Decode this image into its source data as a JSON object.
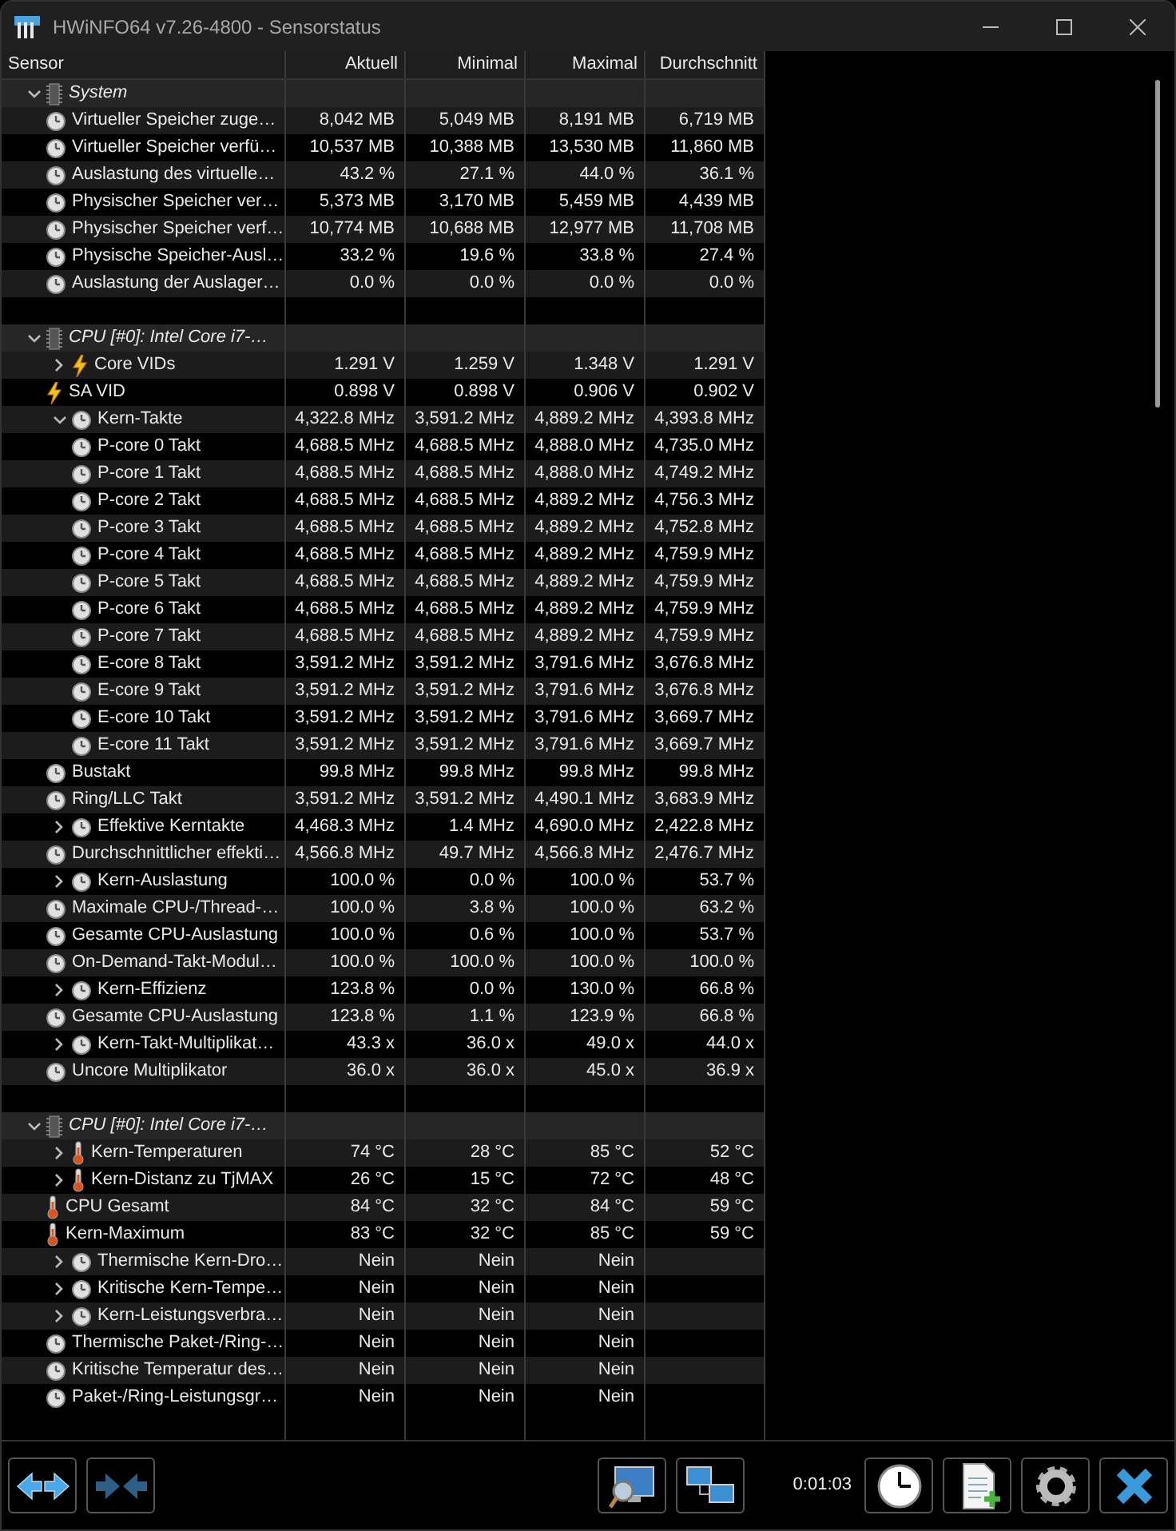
{
  "window": {
    "title": "HWiNFO64 v7.26-4800 - Sensorstatus"
  },
  "columns": [
    "Sensor",
    "Aktuell",
    "Minimal",
    "Maximal",
    "Durchschnitt"
  ],
  "groups": [
    {
      "label": "System",
      "expanded": true,
      "children": [
        {
          "label": "Virtueller Speicher zuge…",
          "kind": "gauge",
          "values": [
            "8,042 MB",
            "5,049 MB",
            "8,191 MB",
            "6,719 MB"
          ]
        },
        {
          "label": "Virtueller Speicher verfü…",
          "kind": "gauge",
          "values": [
            "10,537 MB",
            "10,388 MB",
            "13,530 MB",
            "11,860 MB"
          ]
        },
        {
          "label": "Auslastung des virtuelle…",
          "kind": "gauge",
          "values": [
            "43.2 %",
            "27.1 %",
            "44.0 %",
            "36.1 %"
          ]
        },
        {
          "label": "Physischer Speicher ver…",
          "kind": "gauge",
          "values": [
            "5,373 MB",
            "3,170 MB",
            "5,459 MB",
            "4,439 MB"
          ]
        },
        {
          "label": "Physischer Speicher verf…",
          "kind": "gauge",
          "values": [
            "10,774 MB",
            "10,688 MB",
            "12,977 MB",
            "11,708 MB"
          ]
        },
        {
          "label": "Physische Speicher-Ausl…",
          "kind": "gauge",
          "values": [
            "33.2 %",
            "19.6 %",
            "33.8 %",
            "27.4 %"
          ]
        },
        {
          "label": "Auslastung der Auslager…",
          "kind": "gauge",
          "values": [
            "0.0 %",
            "0.0 %",
            "0.0 %",
            "0.0 %"
          ]
        }
      ]
    },
    {
      "label": "CPU [#0]: Intel Core i7-…",
      "expanded": true,
      "children": [
        {
          "label": "Core VIDs",
          "kind": "voltage",
          "expanded": false,
          "values": [
            "1.291 V",
            "1.259 V",
            "1.348 V",
            "1.291 V"
          ]
        },
        {
          "label": "SA VID",
          "kind": "voltage",
          "values": [
            "0.898 V",
            "0.898 V",
            "0.906 V",
            "0.902 V"
          ]
        },
        {
          "label": "Kern-Takte",
          "kind": "gauge",
          "expanded": true,
          "values": [
            "4,322.8 MHz",
            "3,591.2 MHz",
            "4,889.2 MHz",
            "4,393.8 MHz"
          ],
          "children": [
            {
              "label": "P-core 0 Takt",
              "kind": "gauge",
              "values": [
                "4,688.5 MHz",
                "4,688.5 MHz",
                "4,888.0 MHz",
                "4,735.0 MHz"
              ]
            },
            {
              "label": "P-core 1 Takt",
              "kind": "gauge",
              "values": [
                "4,688.5 MHz",
                "4,688.5 MHz",
                "4,888.0 MHz",
                "4,749.2 MHz"
              ]
            },
            {
              "label": "P-core 2 Takt",
              "kind": "gauge",
              "values": [
                "4,688.5 MHz",
                "4,688.5 MHz",
                "4,889.2 MHz",
                "4,756.3 MHz"
              ]
            },
            {
              "label": "P-core 3 Takt",
              "kind": "gauge",
              "values": [
                "4,688.5 MHz",
                "4,688.5 MHz",
                "4,889.2 MHz",
                "4,752.8 MHz"
              ]
            },
            {
              "label": "P-core 4 Takt",
              "kind": "gauge",
              "values": [
                "4,688.5 MHz",
                "4,688.5 MHz",
                "4,889.2 MHz",
                "4,759.9 MHz"
              ]
            },
            {
              "label": "P-core 5 Takt",
              "kind": "gauge",
              "values": [
                "4,688.5 MHz",
                "4,688.5 MHz",
                "4,889.2 MHz",
                "4,759.9 MHz"
              ]
            },
            {
              "label": "P-core 6 Takt",
              "kind": "gauge",
              "values": [
                "4,688.5 MHz",
                "4,688.5 MHz",
                "4,889.2 MHz",
                "4,759.9 MHz"
              ]
            },
            {
              "label": "P-core 7 Takt",
              "kind": "gauge",
              "values": [
                "4,688.5 MHz",
                "4,688.5 MHz",
                "4,889.2 MHz",
                "4,759.9 MHz"
              ]
            },
            {
              "label": "E-core 8 Takt",
              "kind": "gauge",
              "values": [
                "3,591.2 MHz",
                "3,591.2 MHz",
                "3,791.6 MHz",
                "3,676.8 MHz"
              ]
            },
            {
              "label": "E-core 9 Takt",
              "kind": "gauge",
              "values": [
                "3,591.2 MHz",
                "3,591.2 MHz",
                "3,791.6 MHz",
                "3,676.8 MHz"
              ]
            },
            {
              "label": "E-core 10 Takt",
              "kind": "gauge",
              "values": [
                "3,591.2 MHz",
                "3,591.2 MHz",
                "3,791.6 MHz",
                "3,669.7 MHz"
              ]
            },
            {
              "label": "E-core 11 Takt",
              "kind": "gauge",
              "values": [
                "3,591.2 MHz",
                "3,591.2 MHz",
                "3,791.6 MHz",
                "3,669.7 MHz"
              ]
            }
          ]
        },
        {
          "label": "Bustakt",
          "kind": "gauge",
          "values": [
            "99.8 MHz",
            "99.8 MHz",
            "99.8 MHz",
            "99.8 MHz"
          ]
        },
        {
          "label": "Ring/LLC Takt",
          "kind": "gauge",
          "values": [
            "3,591.2 MHz",
            "3,591.2 MHz",
            "4,490.1 MHz",
            "3,683.9 MHz"
          ]
        },
        {
          "label": "Effektive Kerntakte",
          "kind": "gauge",
          "expanded": false,
          "values": [
            "4,468.3 MHz",
            "1.4 MHz",
            "4,690.0 MHz",
            "2,422.8 MHz"
          ]
        },
        {
          "label": "Durchschnittlicher effekti…",
          "kind": "gauge",
          "values": [
            "4,566.8 MHz",
            "49.7 MHz",
            "4,566.8 MHz",
            "2,476.7 MHz"
          ]
        },
        {
          "label": "Kern-Auslastung",
          "kind": "gauge",
          "expanded": false,
          "values": [
            "100.0 %",
            "0.0 %",
            "100.0 %",
            "53.7 %"
          ]
        },
        {
          "label": "Maximale CPU-/Thread-…",
          "kind": "gauge",
          "values": [
            "100.0 %",
            "3.8 %",
            "100.0 %",
            "63.2 %"
          ]
        },
        {
          "label": "Gesamte CPU-Auslastung",
          "kind": "gauge",
          "values": [
            "100.0 %",
            "0.6 %",
            "100.0 %",
            "53.7 %"
          ]
        },
        {
          "label": "On-Demand-Takt-Modul…",
          "kind": "gauge",
          "values": [
            "100.0 %",
            "100.0 %",
            "100.0 %",
            "100.0 %"
          ]
        },
        {
          "label": "Kern-Effizienz",
          "kind": "gauge",
          "expanded": false,
          "values": [
            "123.8 %",
            "0.0 %",
            "130.0 %",
            "66.8 %"
          ]
        },
        {
          "label": "Gesamte CPU-Auslastung",
          "kind": "gauge",
          "values": [
            "123.8 %",
            "1.1 %",
            "123.9 %",
            "66.8 %"
          ]
        },
        {
          "label": "Kern-Takt-Multiplikat…",
          "kind": "gauge",
          "expanded": false,
          "values": [
            "43.3 x",
            "36.0 x",
            "49.0 x",
            "44.0 x"
          ]
        },
        {
          "label": "Uncore Multiplikator",
          "kind": "gauge",
          "values": [
            "36.0 x",
            "36.0 x",
            "45.0 x",
            "36.9 x"
          ]
        }
      ]
    },
    {
      "label": "CPU [#0]: Intel Core i7-…",
      "expanded": true,
      "children": [
        {
          "label": "Kern-Temperaturen",
          "kind": "temperature",
          "expanded": false,
          "values": [
            "74 °C",
            "28 °C",
            "85 °C",
            "52 °C"
          ]
        },
        {
          "label": "Kern-Distanz zu TjMAX",
          "kind": "temperature",
          "expanded": false,
          "values": [
            "26 °C",
            "15 °C",
            "72 °C",
            "48 °C"
          ]
        },
        {
          "label": "CPU Gesamt",
          "kind": "temperature",
          "values": [
            "84 °C",
            "32 °C",
            "84 °C",
            "59 °C"
          ]
        },
        {
          "label": "Kern-Maximum",
          "kind": "temperature",
          "values": [
            "83 °C",
            "32 °C",
            "85 °C",
            "59 °C"
          ]
        },
        {
          "label": "Thermische Kern-Dro…",
          "kind": "gauge",
          "expanded": false,
          "values": [
            "Nein",
            "Nein",
            "Nein"
          ]
        },
        {
          "label": "Kritische Kern-Tempe…",
          "kind": "gauge",
          "expanded": false,
          "values": [
            "Nein",
            "Nein",
            "Nein"
          ]
        },
        {
          "label": "Kern-Leistungsverbra…",
          "kind": "gauge",
          "expanded": false,
          "values": [
            "Nein",
            "Nein",
            "Nein"
          ]
        },
        {
          "label": "Thermische Paket-/Ring-…",
          "kind": "gauge",
          "values": [
            "Nein",
            "Nein",
            "Nein"
          ]
        },
        {
          "label": "Kritische Temperatur des…",
          "kind": "gauge",
          "values": [
            "Nein",
            "Nein",
            "Nein"
          ]
        },
        {
          "label": "Paket-/Ring-Leistungsgr…",
          "kind": "gauge",
          "values": [
            "Nein",
            "Nein",
            "Nein"
          ]
        }
      ]
    }
  ],
  "toolbar": {
    "timer": "0:01:03"
  }
}
